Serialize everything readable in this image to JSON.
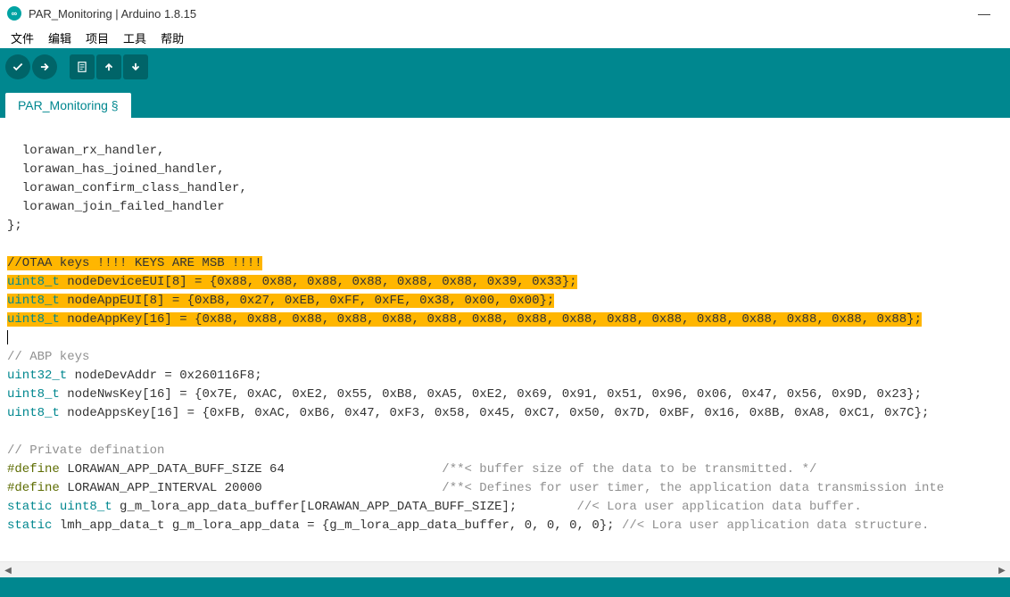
{
  "window": {
    "title": "PAR_Monitoring | Arduino 1.8.15"
  },
  "menubar": {
    "file": "文件",
    "edit": "编辑",
    "project": "项目",
    "tools": "工具",
    "help": "帮助"
  },
  "toolbar_icons": {
    "verify": "check-icon",
    "upload": "arrow-right-icon",
    "new": "file-icon",
    "open": "arrow-up-icon",
    "save": "arrow-down-icon"
  },
  "tab": {
    "name": "PAR_Monitoring §"
  },
  "code": {
    "l1": "  lorawan_rx_handler,",
    "l2": "  lorawan_has_joined_handler,",
    "l3": "  lorawan_confirm_class_handler,",
    "l4": "  lorawan_join_failed_handler",
    "l5": "};",
    "blank1": "",
    "hl1": "//OTAA keys !!!! KEYS ARE MSB !!!!",
    "hl2kw": "uint8_t",
    "hl2rest": " nodeDeviceEUI[8] = {0x88, 0x88, 0x88, 0x88, 0x88, 0x88, 0x39, 0x33};",
    "hl3kw": "uint8_t",
    "hl3rest": " nodeAppEUI[8] = {0xB8, 0x27, 0xEB, 0xFF, 0xFE, 0x38, 0x00, 0x00};",
    "hl4kw": "uint8_t",
    "hl4rest": " nodeAppKey[16] = {0x88, 0x88, 0x88, 0x88, 0x88, 0x88, 0x88, 0x88, 0x88, 0x88, 0x88, 0x88, 0x88, 0x88, 0x88, 0x88};",
    "blank2": "",
    "c1": "// ABP keys",
    "l6kw": "uint32_t",
    "l6rest": " nodeDevAddr = 0x260116F8;",
    "l7kw": "uint8_t",
    "l7rest": " nodeNwsKey[16] = {0x7E, 0xAC, 0xE2, 0x55, 0xB8, 0xA5, 0xE2, 0x69, 0x91, 0x51, 0x96, 0x06, 0x47, 0x56, 0x9D, 0x23};",
    "l8kw": "uint8_t",
    "l8rest": " nodeAppsKey[16] = {0xFB, 0xAC, 0xB6, 0x47, 0xF3, 0x58, 0x45, 0xC7, 0x50, 0x7D, 0xBF, 0x16, 0x8B, 0xA8, 0xC1, 0x7C};",
    "blank3": "",
    "c2": "// Private defination",
    "d1kw": "#define",
    "d1rest": " LORAWAN_APP_DATA_BUFF_SIZE 64                     ",
    "d1c": "/**< buffer size of the data to be transmitted. */",
    "d2kw": "#define",
    "d2rest": " LORAWAN_APP_INTERVAL 20000                        ",
    "d2c": "/**< Defines for user timer, the application data transmission inte",
    "l9a": "static",
    "l9b": "uint8_t",
    "l9rest": " g_m_lora_app_data_buffer[LORAWAN_APP_DATA_BUFF_SIZE];        ",
    "l9c": "//< Lora user application data buffer.",
    "l10a": "static",
    "l10rest": " lmh_app_data_t g_m_lora_app_data = {g_m_lora_app_data_buffer, 0, 0, 0, 0}; ",
    "l10c": "//< Lora user application data structure."
  },
  "colors": {
    "accent": "#00878f",
    "highlight": "#ffb600",
    "keyword": "#00878f",
    "comment": "#909090",
    "define": "#5e6d03"
  }
}
